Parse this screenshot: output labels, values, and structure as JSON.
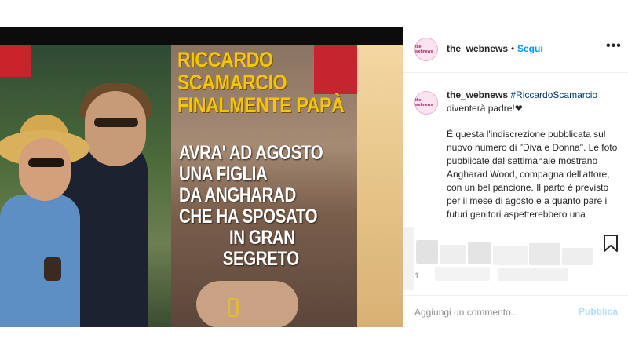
{
  "post_image": {
    "headline": [
      "RICCARDO",
      "SCAMARCIO",
      "FINALMENTE PAPÀ"
    ],
    "subhead": [
      "AVRA' AD AGOSTO",
      "UNA FIGLIA",
      "DA ANGHARAD",
      "CHE HA SPOSATO",
      "IN GRAN",
      "SEGRETO"
    ]
  },
  "header": {
    "avatar_label": "the webnews",
    "username": "the_webnews",
    "separator": "•",
    "follow_label": "Segui",
    "more_icon": "•••"
  },
  "caption": {
    "username": "the_webnews",
    "hashtag": "#RiccardoScamarcio",
    "first_line_rest": "diventerà padre!❤",
    "body": "È questa l'indiscrezione pubblicata sul nuovo numero di \"Diva e Donna\". Le foto pubblicate dal settimanale mostrano Angharad Wood, compagna dell'attore, con un bel pancione. Il parto è previsto per il mese di agosto e a quanto pare i futuri genitori aspetterebbero una"
  },
  "likes": {
    "count_visible": "1"
  },
  "comment": {
    "placeholder": "Aggiungi un commento...",
    "publish_label": "Pubblica"
  },
  "colors": {
    "accent": "#0095f6",
    "publish_disabled": "#b2dffc",
    "headline_yellow": "#f3c600"
  },
  "icons": {
    "save": "bookmark-icon",
    "more": "more-options-icon"
  }
}
